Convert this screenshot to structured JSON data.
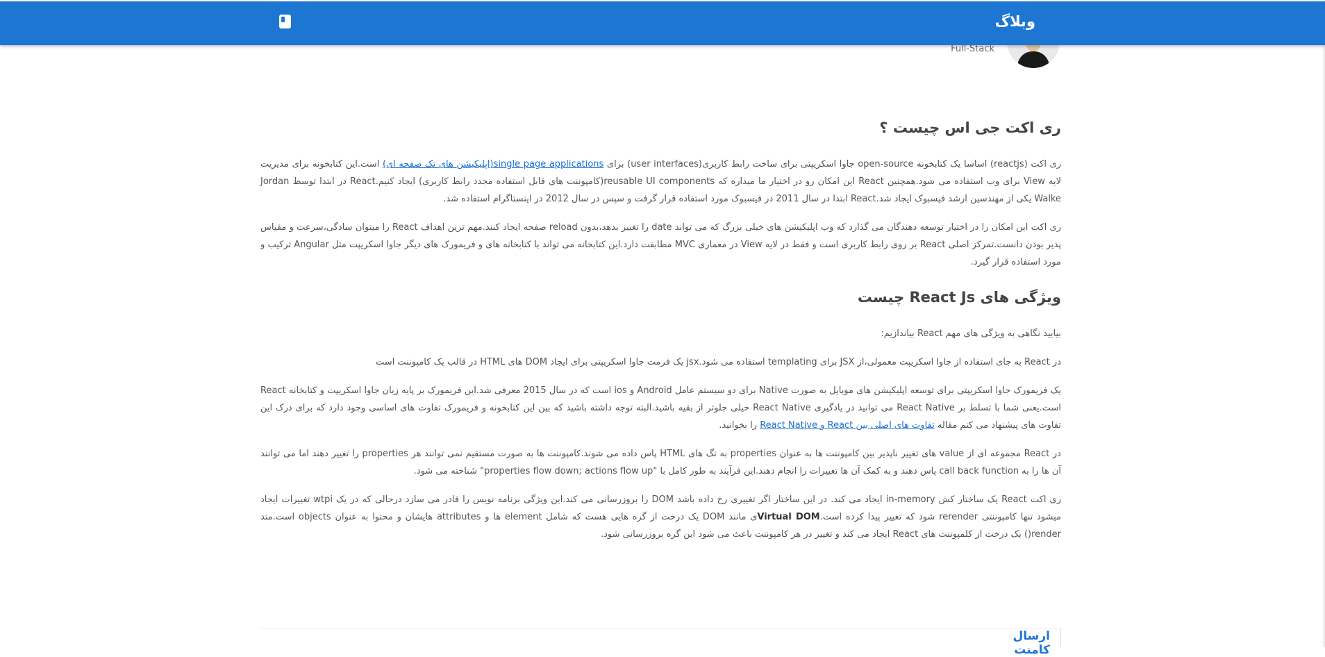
{
  "header": {
    "brand": "وبلاگ",
    "bookmark_icon": "book-icon"
  },
  "author": {
    "role": "Full-Stack"
  },
  "colors": {
    "header_bg": "#1e76d3",
    "link": "#1a6fd1"
  },
  "article": {
    "heading1": "ری اکت جی اس چیست ؟",
    "p1": {
      "a": "ری اکت (reactjs) اساسا یک کتابخونه open-source جاوا اسکریپتی برای ساخت رابط کاربری(user interfaces) برای ",
      "link": "single page applications(اپلیکیشن های تک صفحه ای)",
      "b": " است.این کتابخونه برای مدیریت لایه View برای وب استفاده می شود.همچنین React این امکان رو در اختیار ما میذاره که reusable UI components(کامپوننت های قابل استفاده مجدد رابط کاربری) ایجاد کنیم.React در ابتدا توسط Jordan Walke یکی از مهندسین ارشد فیسبوک ایجاد شد.React ابتدا در سال 2011 در فیسبوک مورد استفاده قرار گرفت و سپس در سال 2012 در اینستاگرام استفاده شد."
    },
    "p2": "ری اکت این امکان را در اختیار توسعه دهندگان می گذارد که وب اپلیکیشن های خیلی بزرگ که می تواند date را تغییر بدهد،بدون reload صفحه ایجاد کنند.مهم ترین اهداف React را میتوان سادگی،سرعت و مقیاس پذیر بودن دانست.تمرکز اصلی React بر روی رابط کاربری است و فقط در لایه View در معماری MVC مطابقت دارد.این کتابخانه می تواند با کتابخانه های و فریمورک های دیگر جاوا اسکریپت مثل Angular ترکیب و مورد استفاده قرار گیرد.",
    "heading2": "ویژگی های React Js چیست",
    "p3": "بیایید نگاهی به ویژگی های مهم React بیاندازیم:",
    "p4": "در React به جای استفاده از جاوا اسکریپت معمولی،از JSX برای templating استفاده می شود.jsx یک فرمت جاوا اسکریپتی برای ایجاد DOM های HTML در قالب یک کامپوننت است",
    "p5": {
      "a": "یک فریمورک جاوا اسکریپتی برای توسعه اپلیکیشن های موبایل به صورت Native برای دو سیستم عامل Android و ios است که در سال 2015 معرفی شد.این فریمورک بر پایه زبان جاوا اسکریپت و کتابخانه React است.یعنی شما با تسلط بر React Native می توانید در یادگیری React Native خیلی جلوتر از بقیه باشید.البته توجه داشته باشید که بین این کتابخونه و فریمورک تفاوت های اساسی وجود دارد که برای درک این تفاوت های پیشنهاد می کنم مقاله ",
      "link": "تفاوت های اصلی بین React و React Native",
      "b": " را بخوانید."
    },
    "p6": "در React مجموعه ای از value های تغییر ناپذیر بین کامپوننت ها به عنوان properties به تگ های HTML پاس داده می شوند.کامپوننت ها به صورت مستقیم نمی توانند هر properties را تغییر دهند اما می توانند آن ها را به call back function پاس دهند و به کمک آن ها تغییرات را انجام دهند.این فرآیند به طور کامل با \"properties flow down; actions flow up\" شناخته می شود.",
    "p7": {
      "a": "ری اکت React یک ساختار کش in-memory ایجاد می کند. در این ساختار اگر تغییری رخ داده باشد DOM را بروزرسانی می کند.این ویژگی برنامه نویس را قادر می سازد درحالی که در یک wtpi تغییرات ایجاد میشود تنها کامپوننتی rerender شود که تغییر پیدا کرده است.",
      "bold": "Virtual DOM",
      "b": "ی مانند DOM یک درخت از گره هایی هست که شامل element ها و attributes هایشان و محتوا به عنوان objects است.متد render() یک درخت از کلمپوننت های React ایجاد می کند و تغییر در هر کامپوننت باعث می شود این گره بروزرسانی شود."
    }
  },
  "comments": {
    "title": "ارسال کامنت"
  }
}
